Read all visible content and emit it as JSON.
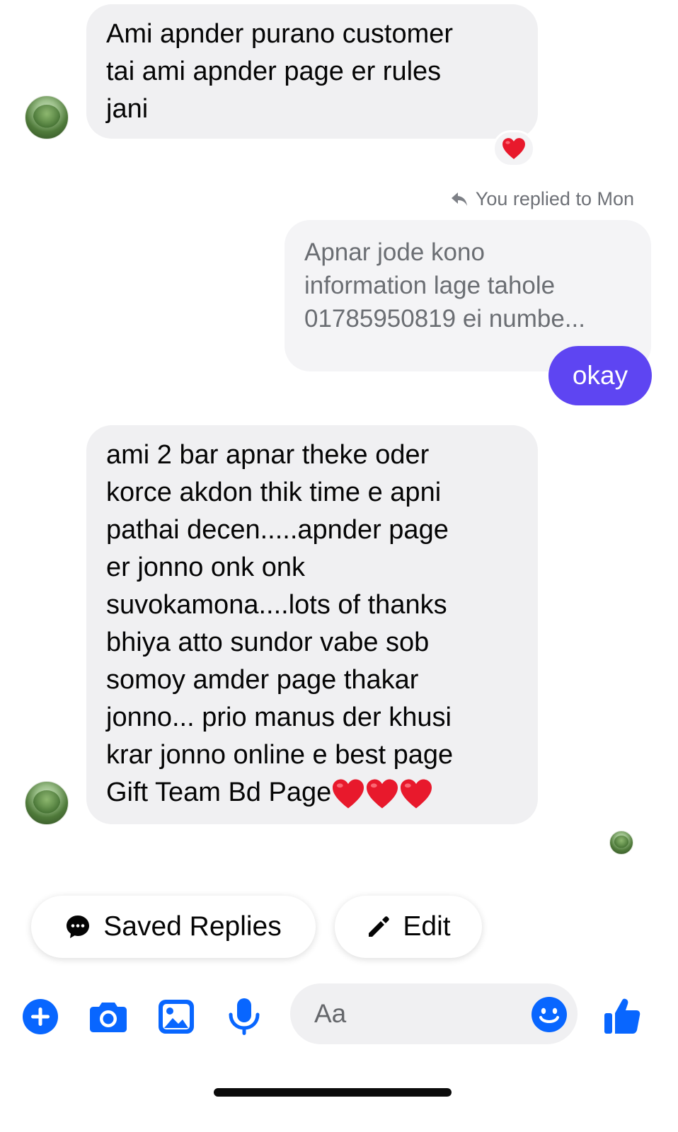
{
  "messages": {
    "first": {
      "lines": [
        "Ami apnder purano customer",
        "tai ami apnder page er rules",
        "jani"
      ]
    },
    "reply_label": "You replied to Mon",
    "quoted": {
      "lines": [
        "Apnar jode kono",
        "information lage tahole",
        "01785950819 ei numbe..."
      ]
    },
    "outgoing": "okay",
    "second": {
      "lines": [
        "ami 2 bar apnar theke oder",
        "korce akdon thik time e apni",
        "pathai decen.....apnder page",
        "er jonno onk onk",
        "suvokamona....lots of thanks",
        "bhiya atto sundor vabe sob",
        "somoy amder page thakar",
        "jonno... prio manus der khusi",
        "krar jonno online e best page"
      ],
      "last_line": "Gift Team Bd Page"
    }
  },
  "quick_replies": {
    "saved_replies": "Saved Replies",
    "edit": "Edit"
  },
  "composer": {
    "placeholder": "Aa"
  },
  "colors": {
    "accent": "#0866ff",
    "outgoing_bubble": "#5e45f2",
    "incoming_bubble": "#f0f0f2",
    "heart": "#e8192c"
  },
  "icons": [
    "plus-icon",
    "camera-icon",
    "gallery-icon",
    "microphone-icon",
    "emoji-icon",
    "like-icon",
    "reply-arrow-icon",
    "chat-bubble-icon",
    "pencil-icon",
    "heart-icon"
  ]
}
